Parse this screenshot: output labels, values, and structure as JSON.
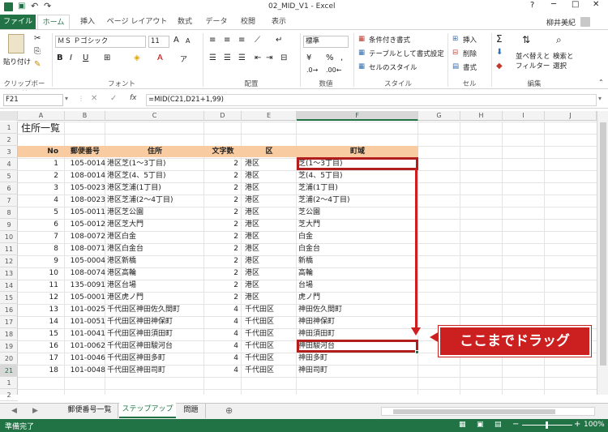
{
  "window": {
    "title": "02_MID_V1 - Excel",
    "user": "柳井美紀"
  },
  "tabs": [
    "ファイル",
    "ホーム",
    "挿入",
    "ページ レイアウト",
    "数式",
    "データ",
    "校閲",
    "表示"
  ],
  "ribbon": {
    "clipboard": {
      "paste": "貼り付け",
      "label": "クリップボード"
    },
    "font": {
      "name": "ＭＳ Ｐゴシック",
      "size": "11",
      "bold": "B",
      "italic": "I",
      "underline": "U",
      "a_big": "A",
      "a_small": "A",
      "font_color": "A",
      "label": "フォント"
    },
    "align": {
      "label": "配置"
    },
    "number": {
      "format": "標準",
      "percent": "%",
      "comma": ",",
      "label": "数値"
    },
    "styles": {
      "conditional": "条件付き書式",
      "table": "テーブルとして書式設定",
      "cell_style": "セルのスタイル",
      "label": "スタイル"
    },
    "cells": {
      "insert": "挿入",
      "delete": "削除",
      "format": "書式",
      "label": "セル"
    },
    "edit": {
      "sort": "並べ替えと",
      "filter": "フィルター",
      "find": "検索と",
      "select": "選択",
      "label": "編集"
    }
  },
  "formula_bar": {
    "name_box": "F21",
    "fx": "fx",
    "formula": "=MID(C21,D21+1,99)"
  },
  "columns": [
    "A",
    "B",
    "C",
    "D",
    "E",
    "F",
    "G",
    "H",
    "I",
    "J"
  ],
  "rows": [
    "1",
    "2",
    "3",
    "4",
    "5",
    "6",
    "7",
    "8",
    "9",
    "10",
    "11",
    "12",
    "13",
    "14",
    "15",
    "16",
    "17",
    "18",
    "19",
    "20",
    "21",
    "1",
    "2",
    "3"
  ],
  "sheet": {
    "title": "住所一覧",
    "headers": [
      "No",
      "郵便番号",
      "住所",
      "文字数",
      "区",
      "町域"
    ],
    "data": [
      [
        "1",
        "105-0014",
        "港区芝(1～3丁目)",
        "2",
        "港区",
        "芝(1～3丁目)"
      ],
      [
        "2",
        "108-0014",
        "港区芝(4、5丁目)",
        "2",
        "港区",
        "芝(4、5丁目)"
      ],
      [
        "3",
        "105-0023",
        "港区芝浦(1丁目)",
        "2",
        "港区",
        "芝浦(1丁目)"
      ],
      [
        "4",
        "108-0023",
        "港区芝浦(2～4丁目)",
        "2",
        "港区",
        "芝浦(2～4丁目)"
      ],
      [
        "5",
        "105-0011",
        "港区芝公園",
        "2",
        "港区",
        "芝公園"
      ],
      [
        "6",
        "105-0012",
        "港区芝大門",
        "2",
        "港区",
        "芝大門"
      ],
      [
        "7",
        "108-0072",
        "港区白金",
        "2",
        "港区",
        "白金"
      ],
      [
        "8",
        "108-0071",
        "港区白金台",
        "2",
        "港区",
        "白金台"
      ],
      [
        "9",
        "105-0004",
        "港区新橋",
        "2",
        "港区",
        "新橋"
      ],
      [
        "10",
        "108-0074",
        "港区高輪",
        "2",
        "港区",
        "高輪"
      ],
      [
        "11",
        "135-0091",
        "港区台場",
        "2",
        "港区",
        "台場"
      ],
      [
        "12",
        "105-0001",
        "港区虎ノ門",
        "2",
        "港区",
        "虎ノ門"
      ],
      [
        "13",
        "101-0025",
        "千代田区神田佐久間町",
        "4",
        "千代田区",
        "神田佐久間町"
      ],
      [
        "14",
        "101-0051",
        "千代田区神田神保町",
        "4",
        "千代田区",
        "神田神保町"
      ],
      [
        "15",
        "101-0041",
        "千代田区神田須田町",
        "4",
        "千代田区",
        "神田須田町"
      ],
      [
        "16",
        "101-0062",
        "千代田区神田駿河台",
        "4",
        "千代田区",
        "神田駿河台"
      ],
      [
        "17",
        "101-0046",
        "千代田区神田多町",
        "4",
        "千代田区",
        "神田多町"
      ],
      [
        "18",
        "101-0048",
        "千代田区神田司町",
        "4",
        "千代田区",
        "神田司町"
      ]
    ]
  },
  "callout": {
    "text": "ここまでドラッグ",
    "color": "#cc1f1f"
  },
  "sheet_tabs": [
    "郵便番号一覧",
    "ステップアップ",
    "問題"
  ],
  "status": {
    "ready": "準備完了",
    "zoom": "100%"
  },
  "colors": {
    "header_fill": "#f8cba0",
    "excel_green": "#217346"
  }
}
